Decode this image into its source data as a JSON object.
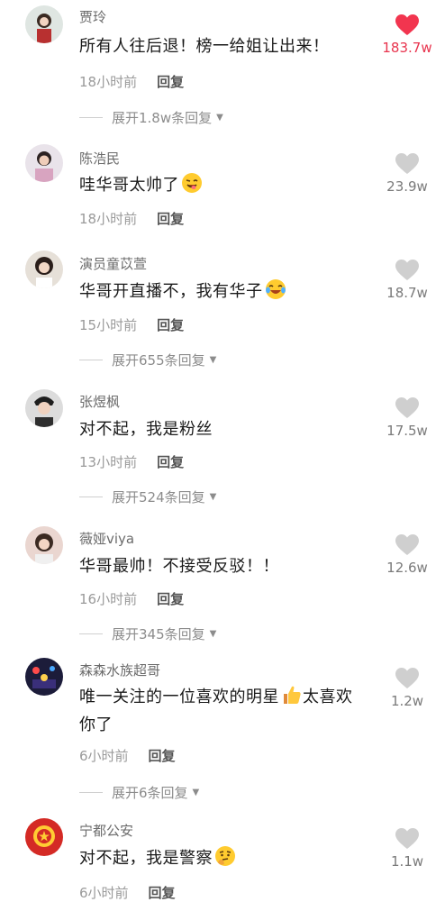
{
  "colors": {
    "liked": "#f2354f",
    "unliked": "#cfcfcf"
  },
  "comments": [
    {
      "name": "贾玲",
      "text": "所有人往后退！榜一给姐让出来！",
      "time": "18小时前",
      "reply": "回复",
      "likes": "183.7w",
      "liked": true,
      "expand": "展开1.8w条回复"
    },
    {
      "name": "陈浩民",
      "text": "哇华哥太帅了",
      "emoji": "wink-tongue-emoji",
      "time": "18小时前",
      "reply": "回复",
      "likes": "23.9w"
    },
    {
      "name": "演员童苡萱",
      "text": "华哥开直播不，我有华子",
      "emoji": "laugh-tears-emoji",
      "time": "15小时前",
      "reply": "回复",
      "likes": "18.7w",
      "expand": "展开655条回复"
    },
    {
      "name": "张煜枫",
      "text": "对不起，我是粉丝",
      "time": "13小时前",
      "reply": "回复",
      "likes": "17.5w",
      "expand": "展开524条回复"
    },
    {
      "name": "薇娅viya",
      "text": "华哥最帅！不接受反驳！！",
      "time": "16小时前",
      "reply": "回复",
      "likes": "12.6w",
      "expand": "展开345条回复"
    },
    {
      "name": "森森水族超哥",
      "text_a": "唯一关注的一位喜欢的明星",
      "emoji": "thumbs-up-emoji",
      "text_b": "太喜欢",
      "text_c": "你了",
      "time": "6小时前",
      "reply": "回复",
      "likes": "1.2w",
      "expand": "展开6条回复"
    },
    {
      "name": "宁都公安",
      "text": "对不起，我是警察",
      "emoji": "thinking-emoji",
      "time": "6小时前",
      "reply": "回复",
      "likes": "1.1w"
    }
  ]
}
